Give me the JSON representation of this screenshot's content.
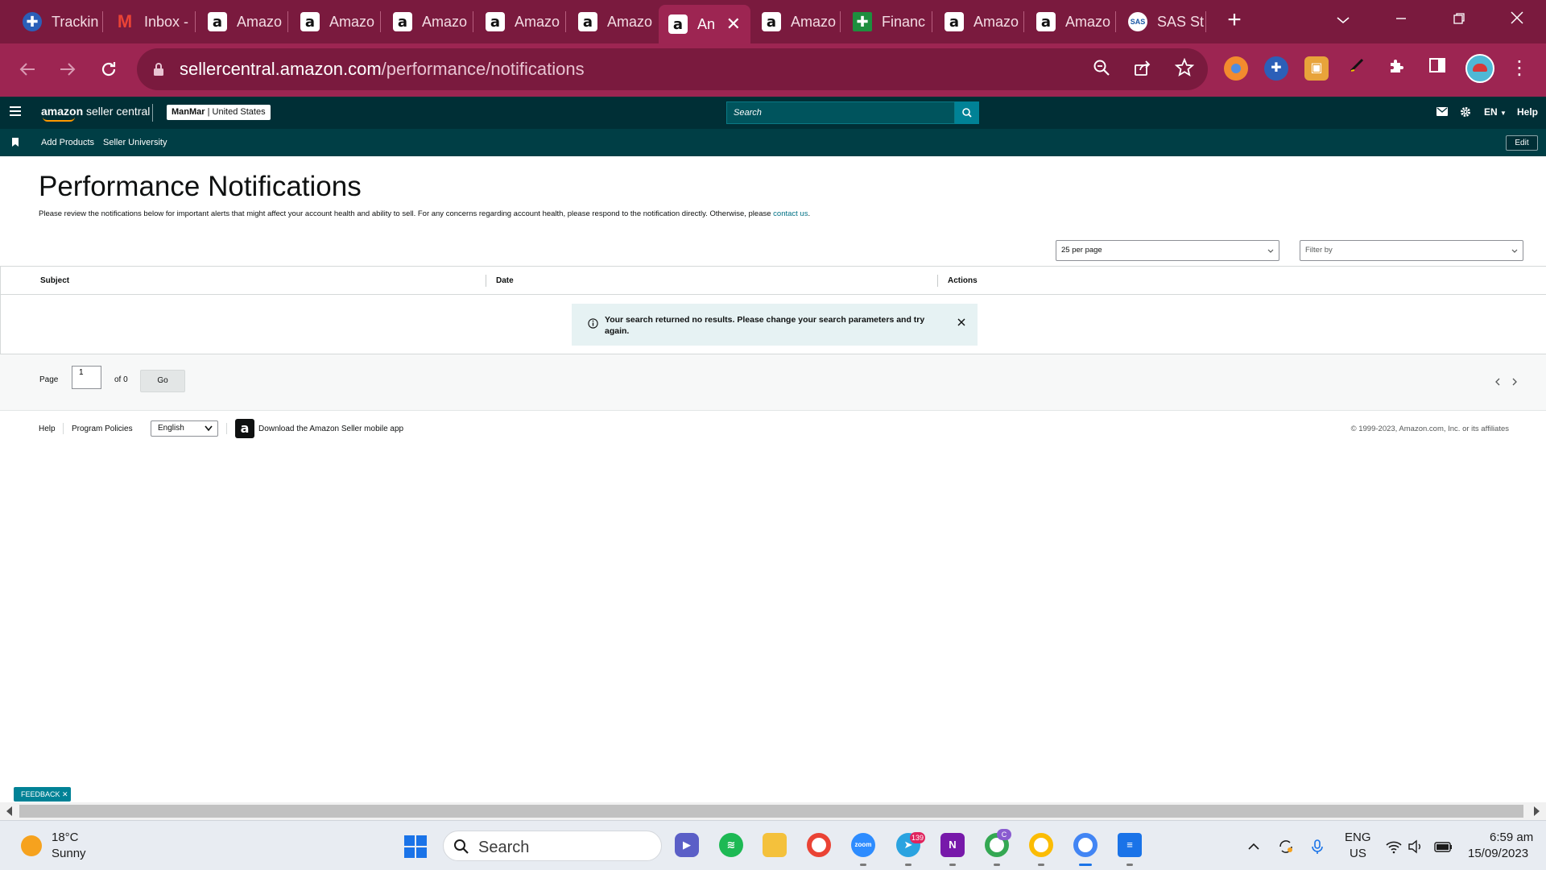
{
  "browser": {
    "tabs": [
      {
        "label": "Trackin",
        "icon": "plus-tracker-icon",
        "active": false
      },
      {
        "label": "Inbox -",
        "icon": "gmail-icon",
        "active": false
      },
      {
        "label": "Amazo",
        "icon": "amazon-icon",
        "active": false
      },
      {
        "label": "Amazo",
        "icon": "amazon-icon",
        "active": false
      },
      {
        "label": "Amazo",
        "icon": "amazon-icon",
        "active": false
      },
      {
        "label": "Amazo",
        "icon": "amazon-icon",
        "active": false
      },
      {
        "label": "Amazo",
        "icon": "amazon-icon",
        "active": false
      },
      {
        "label": "An",
        "icon": "amazon-icon",
        "active": true
      },
      {
        "label": "Amazo",
        "icon": "amazon-icon",
        "active": false
      },
      {
        "label": "Financ",
        "icon": "finance-plus-icon",
        "active": false
      },
      {
        "label": "Amazo",
        "icon": "amazon-icon",
        "active": false
      },
      {
        "label": "Amazo",
        "icon": "amazon-icon",
        "active": false
      },
      {
        "label": "SAS St",
        "icon": "sas-icon",
        "active": false
      }
    ],
    "url_host": "sellercentral.amazon.com",
    "url_path": "/performance/notifications",
    "theme_color": "#9d2552",
    "tabstrip_color": "#7a1a3e"
  },
  "sc_header": {
    "logo_bold": "amazon",
    "logo_rest": " seller central",
    "store_name": "ManMar",
    "store_region": " | United States",
    "search_placeholder": "Search",
    "language": "EN",
    "help": "Help",
    "color": "#002f36"
  },
  "sc_bookmarks": {
    "items": [
      "Add Products",
      "Seller University"
    ],
    "edit": "Edit"
  },
  "page": {
    "title": "Performance Notifications",
    "description": "Please review the notifications below for important alerts that might affect your account health and ability to sell. For any concerns regarding account health, please respond to the notification directly. Otherwise, please ",
    "contact_link": "contact us",
    "contact_after": ".",
    "per_page": "25 per page",
    "filter_placeholder": "Filter by"
  },
  "table": {
    "columns": [
      "Subject",
      "Date",
      "Actions"
    ],
    "empty_message": "Your search returned no results. Please change your search parameters and try again."
  },
  "pager": {
    "page_label": "Page",
    "page_value": "1",
    "of_label": "of 0",
    "go": "Go"
  },
  "footer": {
    "help": "Help",
    "policies": "Program Policies",
    "language": "English",
    "app_text": "Download the Amazon Seller mobile app",
    "copyright": "© 1999-2023, Amazon.com, Inc. or its affiliates"
  },
  "feedback": {
    "label": "FEEDBACK"
  },
  "taskbar": {
    "weather_temp": "18°C",
    "weather_cond": "Sunny",
    "search": "Search",
    "telegram_badge": "139",
    "chrome_profile_badge": "C",
    "lang_top": "ENG",
    "lang_bottom": "US",
    "time": "6:59 am",
    "date": "15/09/2023"
  }
}
